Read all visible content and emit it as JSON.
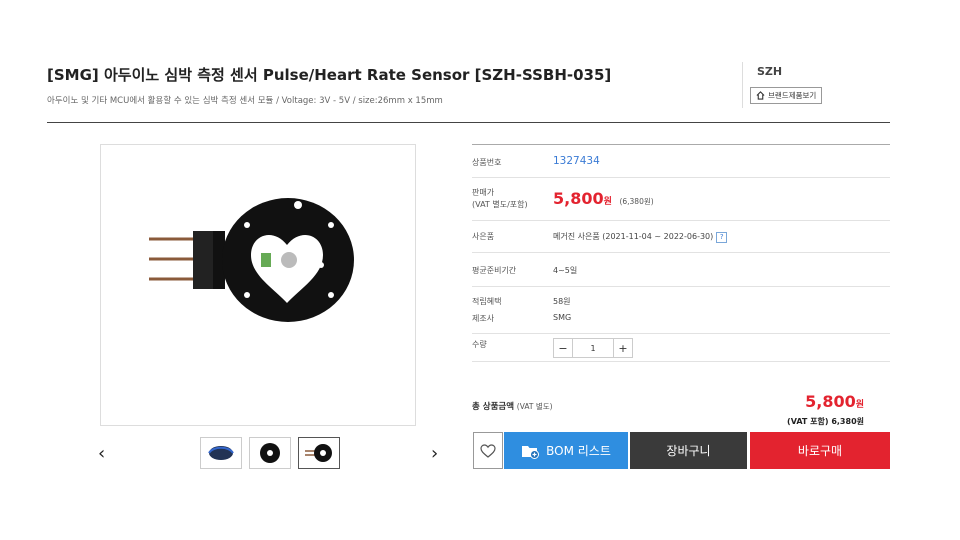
{
  "product": {
    "title": "[SMG] 아두이노 심박 측정 센서 Pulse/Heart Rate Sensor [SZH-SSBH-035]",
    "subtitle": "아두이노 및 기타 MCU에서 활용할 수 있는 심박 측정 센서 모듈 / Voltage: 3V - 5V / size:26mm x 15mm"
  },
  "brand": {
    "name": "SZH",
    "button_label": "브랜드제품보기",
    "icon": "home-icon"
  },
  "gallery": {
    "prev_icon": "‹",
    "next_icon": "›",
    "thumbnails": [
      "thumb-1",
      "thumb-2",
      "thumb-3"
    ]
  },
  "details": {
    "code_label": "상품번호",
    "code_value": "1327434",
    "price_label_1": "판매가",
    "price_label_2": "(VAT 별도/포함)",
    "price_value": "5,800",
    "price_unit": "원",
    "price_vat": "(6,380원)",
    "gift_label": "사은품",
    "gift_value": "메거진 사은품 (2021-11-04 ~ 2022-06-30)",
    "gift_help": "?",
    "prep_label": "평균준비기간",
    "prep_value": "4~5일",
    "points_label": "적립혜택",
    "points_value": "58원",
    "maker_label": "제조사",
    "maker_value": "SMG",
    "qty_label": "수량",
    "qty_minus": "−",
    "qty_value": "1",
    "qty_plus": "+"
  },
  "total": {
    "label": "총 상품금액",
    "label_sub": "(VAT 별도)",
    "price": "5,800",
    "unit": "원",
    "vat_line": "(VAT 포함) 6,380원"
  },
  "actions": {
    "bom_label": "BOM 리스트",
    "cart_label": "장바구니",
    "buy_label": "바로구매"
  },
  "colors": {
    "accent_red": "#e3232f",
    "bom_blue": "#2f8ee0",
    "cart_dark": "#3a3a3a",
    "link_blue": "#3a7bd5"
  }
}
